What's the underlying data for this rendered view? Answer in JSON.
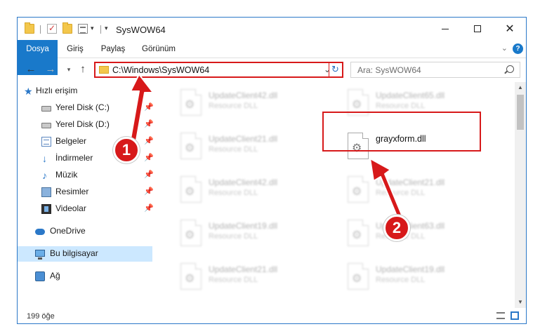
{
  "window": {
    "title": "SysWOW64"
  },
  "ribbon": {
    "tabs": [
      "Dosya",
      "Giriş",
      "Paylaş",
      "Görünüm"
    ],
    "help": "?"
  },
  "address": {
    "path": "C:\\Windows\\SysWOW64"
  },
  "search": {
    "placeholder": "Ara: SysWOW64"
  },
  "sidebar": {
    "items": [
      {
        "label": "Hızlı erişim",
        "icon": "star-icon"
      },
      {
        "label": "Yerel Disk (C:)",
        "icon": "drive-icon"
      },
      {
        "label": "Yerel Disk (D:)",
        "icon": "drive-icon"
      },
      {
        "label": "Belgeler",
        "icon": "documents-icon"
      },
      {
        "label": "İndirmeler",
        "icon": "downloads-icon"
      },
      {
        "label": "Müzik",
        "icon": "music-icon"
      },
      {
        "label": "Resimler",
        "icon": "pictures-icon"
      },
      {
        "label": "Videolar",
        "icon": "videos-icon"
      },
      {
        "label": "OneDrive",
        "icon": "cloud-icon"
      },
      {
        "label": "Bu bilgisayar",
        "icon": "computer-icon"
      },
      {
        "label": "Ağ",
        "icon": "network-icon"
      }
    ]
  },
  "files": [
    {
      "name": "UpdateClient42.dll",
      "type": "Resource DLL"
    },
    {
      "name": "UpdateClient65.dll",
      "type": "Resource DLL"
    },
    {
      "name": "UpdateClient21.dll",
      "type": "Resource DLL"
    },
    {
      "name": "grayxform.dll",
      "type": ""
    },
    {
      "name": "UpdateClient42.dll",
      "type": "Resource DLL"
    },
    {
      "name": "UpdateClient21.dll",
      "type": "Resource DLL"
    },
    {
      "name": "UpdateClient19.dll",
      "type": "Resource DLL"
    },
    {
      "name": "UpdateClient63.dll",
      "type": "Resource DLL"
    },
    {
      "name": "UpdateClient21.dll",
      "type": "Resource DLL"
    },
    {
      "name": "UpdateClient19.dll",
      "type": "Resource DLL"
    }
  ],
  "status": {
    "count": "199 öğe"
  },
  "annotations": {
    "step1": "1",
    "step2": "2",
    "color": "#d7191a"
  },
  "colors": {
    "accent": "#1979ca",
    "selection": "#cce8ff"
  }
}
